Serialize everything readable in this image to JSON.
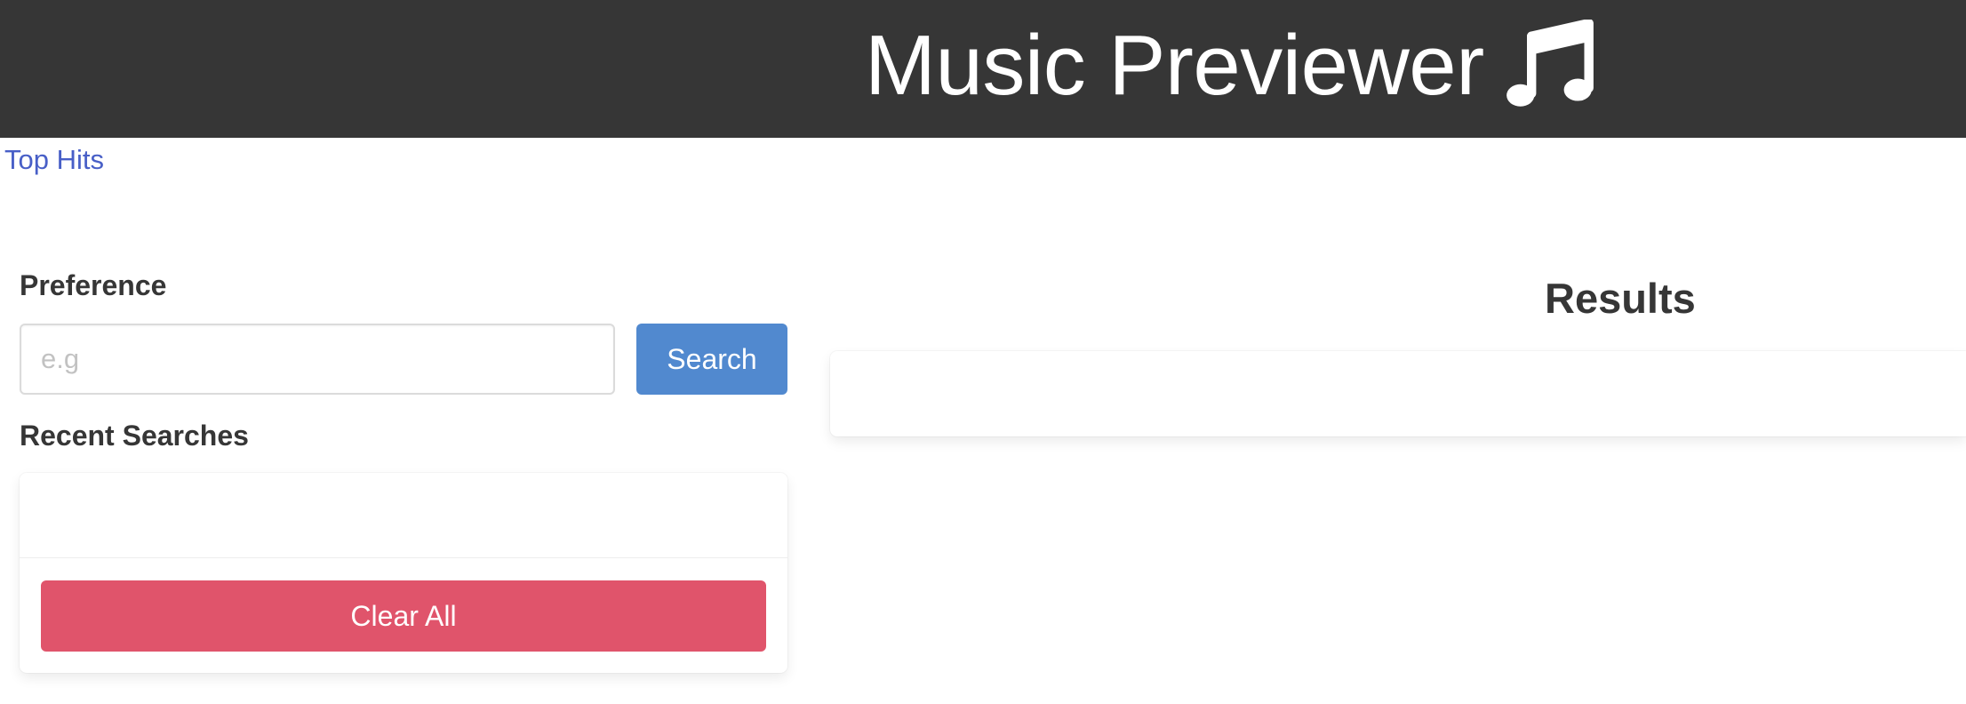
{
  "header": {
    "title": "Music Previewer",
    "icon": "music-note-icon"
  },
  "nav": {
    "top_hits_label": "Top Hits"
  },
  "search": {
    "label": "Preference",
    "placeholder": "e.g",
    "value": "",
    "button_label": "Search"
  },
  "recent": {
    "label": "Recent Searches",
    "items": [],
    "clear_label": "Clear All"
  },
  "results": {
    "title": "Results",
    "items": []
  },
  "colors": {
    "header_bg": "#363636",
    "link": "#485fc7",
    "search_button": "#5189cf",
    "clear_button": "#e0546b"
  }
}
